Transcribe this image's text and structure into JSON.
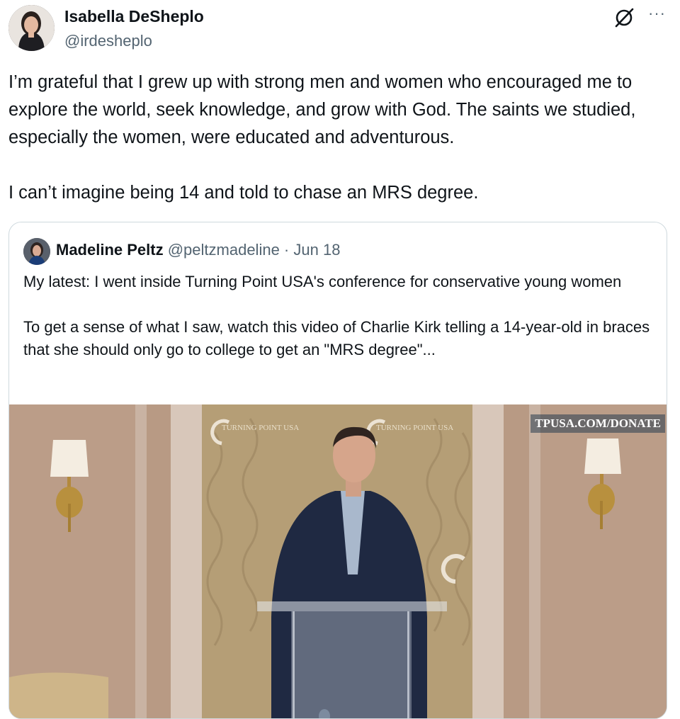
{
  "tweet": {
    "author_name": "Isabella DeSheplo",
    "author_handle": "@irdesheplo",
    "more_label": "···",
    "paragraphs": [
      "I’m grateful that I grew up with strong men and women who encouraged me to explore the world, seek knowledge, and grow with God. The saints we studied, especially the women, were educated and adventurous.",
      "I can’t imagine being 14 and told to chase an MRS degree."
    ]
  },
  "quote": {
    "author_name": "Madeline Peltz",
    "author_handle": "@peltzmadeline",
    "separator": " · ",
    "date": "Jun 18",
    "paragraphs": [
      "My latest: I went inside Turning Point USA's conference for conservative young women",
      "To get a sense of what I saw, watch this video of Charlie Kirk telling a 14-year-old in braces that she should only go to college to get an \"MRS degree\"..."
    ],
    "media": {
      "watermark": "TPUSA.COM/DONATE",
      "backdrop_logo_text": "TURNING POINT USA"
    }
  },
  "icons": [
    "grok-icon",
    "more-icon"
  ]
}
